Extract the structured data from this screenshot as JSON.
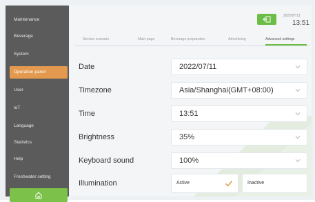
{
  "sidebar": {
    "items": [
      {
        "label": "Maintenance"
      },
      {
        "label": "Beverage"
      },
      {
        "label": "System"
      },
      {
        "label": "Operation panel"
      },
      {
        "label": "User"
      },
      {
        "label": "IoT"
      },
      {
        "label": "Language"
      },
      {
        "label": "Statistics"
      },
      {
        "label": "Help"
      },
      {
        "label": "Freshwater setting"
      }
    ],
    "active_index": 3
  },
  "header": {
    "date": "2022/07/11",
    "time": "13:51"
  },
  "tabs": [
    {
      "label": "Service scenario"
    },
    {
      "label": "Main page"
    },
    {
      "label": "Beverage preparation"
    },
    {
      "label": "Advertising"
    },
    {
      "label": "Advanced settings"
    }
  ],
  "active_tab": 4,
  "settings": {
    "date": {
      "label": "Date",
      "value": "2022/07/11"
    },
    "timezone": {
      "label": "Timezone",
      "value": "Asia/Shanghai(GMT+08:00)"
    },
    "time": {
      "label": "Time",
      "value": "13:51"
    },
    "brightness": {
      "label": "Brightness",
      "value": "35%"
    },
    "keyboard_sound": {
      "label": "Keyboard sound",
      "value": "100%"
    },
    "illumination": {
      "label": "Illumination",
      "options": [
        "Active",
        "Inactive"
      ],
      "selected": "Active"
    }
  },
  "colors": {
    "accent_green": "#6bbd46",
    "accent_orange": "#e39a4f",
    "sidebar": "#5b5b5b"
  }
}
